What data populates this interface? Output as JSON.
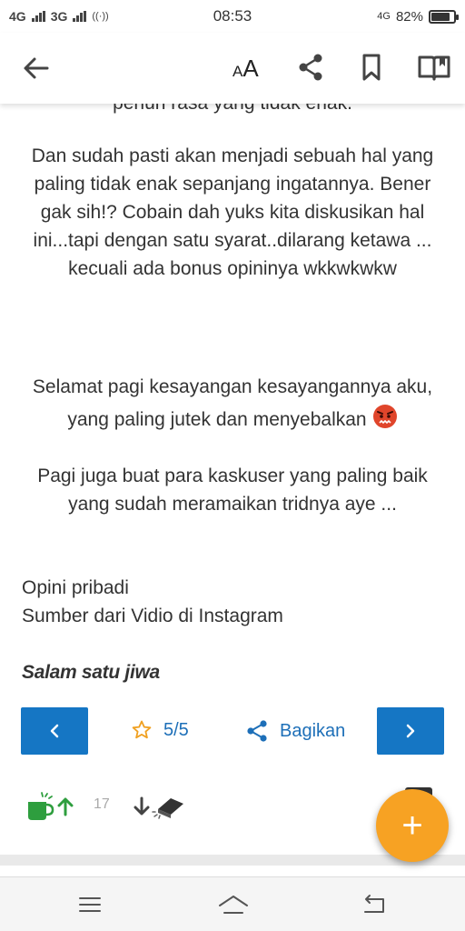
{
  "status_bar": {
    "network_1": "4G",
    "network_2": "3G",
    "time": "08:53",
    "network_right": "4G",
    "battery_percent": "82%",
    "battery_level": 0.82
  },
  "toolbar": {
    "text_size_small": "A",
    "text_size_large": "A",
    "icons": [
      "back-arrow-icon",
      "text-size-icon",
      "share-icon",
      "bookmark-icon",
      "open-book-icon"
    ]
  },
  "article": {
    "cut_line": "penuh rasa yang tidak enak.",
    "paragraph_1": "Dan sudah pasti akan menjadi sebuah hal yang paling tidak enak sepanjang ingatannya. Bener gak sih!? Cobain dah yuks kita diskusikan hal ini...tapi dengan satu syarat..dilarang ketawa ... kecuali ada bonus opininya wkkwkwkw",
    "paragraph_2": "Selamat pagi kesayangan kesayangannya aku, yang paling jutek dan menyebalkan",
    "paragraph_3": "Pagi juga buat para kaskuser yang paling baik yang sudah meramaikan tridnya aye ...",
    "opini": "Opini pribadi",
    "sumber": "Sumber dari Vidio di Instagram",
    "salam": "Salam satu jiwa"
  },
  "pager": {
    "rating": "5/5",
    "share_label": "Bagikan"
  },
  "votes": {
    "count": "17"
  },
  "fab": {
    "label": "+"
  },
  "colors": {
    "primary_blue": "#1576c4",
    "link_blue": "#1d6fb8",
    "fab_orange": "#f7a223",
    "star_orange": "#f0a020",
    "cendol_green": "#2e9e3e"
  }
}
